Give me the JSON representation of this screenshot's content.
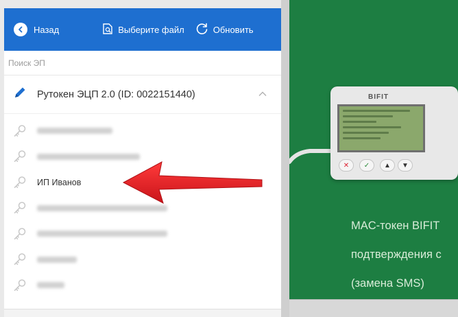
{
  "toolbar": {
    "back_label": "Назад",
    "file_label": "Выберите файл",
    "refresh_label": "Обновить",
    "bg_color": "#1e6fd0"
  },
  "search": {
    "label": "Поиск ЭП"
  },
  "token": {
    "name": "Рутокен ЭЦП 2.0 (ID: 0022151440)",
    "icon": "pen-icon",
    "expanded": true
  },
  "keys": [
    {
      "name": "",
      "blurred": true,
      "blur_width": 110
    },
    {
      "name": "",
      "blurred": true,
      "blur_width": 150
    },
    {
      "name": "ИП Иванов",
      "blurred": false
    },
    {
      "name": "",
      "blurred": true,
      "blur_width": 190
    },
    {
      "name": "",
      "blurred": true,
      "blur_width": 190
    },
    {
      "name": "",
      "blurred": true,
      "blur_width": 58
    },
    {
      "name": "",
      "blurred": true,
      "blur_width": 40
    }
  ],
  "device": {
    "brand": "BIFIT"
  },
  "promo": {
    "lines": [
      "MAC-токен BIFIT",
      "подтверждения с",
      "(замена SMS)"
    ]
  },
  "colors": {
    "accent": "#1e6fd0",
    "promo_bg": "#1d7e42",
    "arrow": "#e8262a"
  }
}
